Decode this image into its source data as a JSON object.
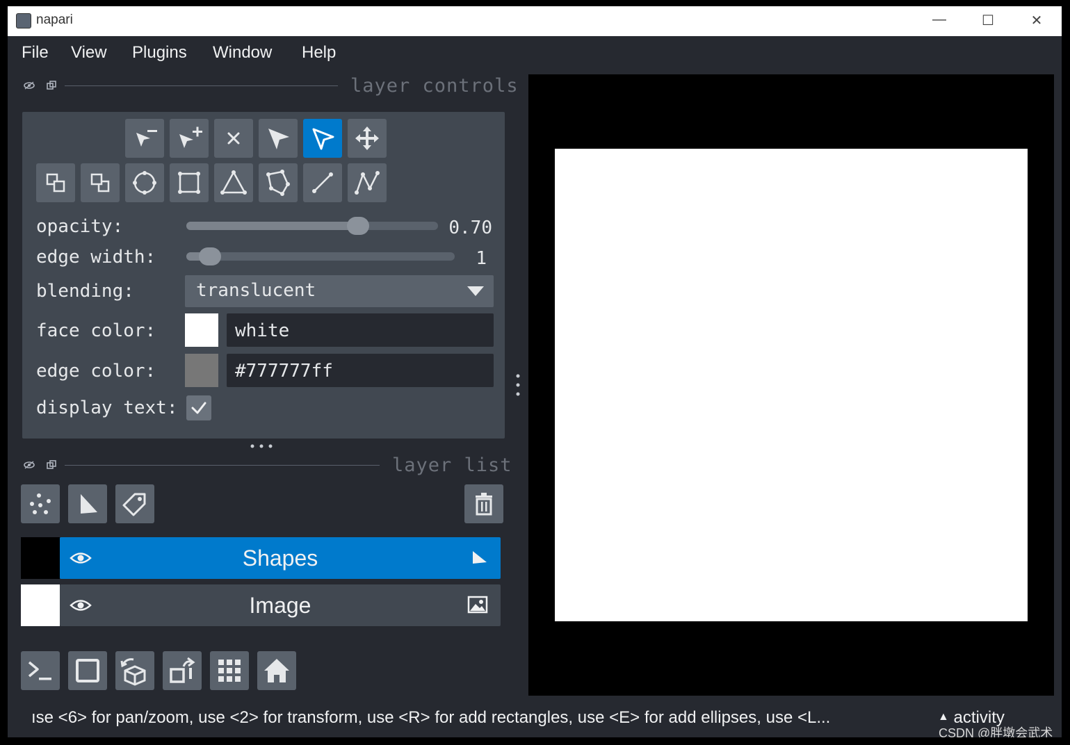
{
  "window": {
    "title": "napari",
    "controls": {
      "minimize": "—",
      "maximize": "☐",
      "close": "✕"
    }
  },
  "menu": [
    "File",
    "View",
    "Plugins",
    "Window",
    "Help"
  ],
  "layer_controls": {
    "title": "layer controls",
    "opacity": {
      "label": "opacity:",
      "value": "0.70",
      "level": 0.7
    },
    "edge_width": {
      "label": "edge width:",
      "value": "1",
      "level": 0.05
    },
    "blending": {
      "label": "blending:",
      "value": "translucent"
    },
    "face_color": {
      "label": "face color:",
      "value": "white",
      "swatch": "#ffffff"
    },
    "edge_color": {
      "label": "edge color:",
      "value": "#777777ff",
      "swatch": "#777777"
    },
    "display_text": {
      "label": "display text:",
      "checked": true
    },
    "active_color": "#007acc"
  },
  "layer_list": {
    "title": "layer list",
    "layers": [
      {
        "name": "Shapes",
        "selected": true,
        "thumb": "#000000",
        "type_icon": "shapes-icon"
      },
      {
        "name": "Image",
        "selected": false,
        "thumb": "#ffffff",
        "type_icon": "image-icon"
      }
    ]
  },
  "status": {
    "message": "ıse <6> for pan/zoom, use <2> for transform, use <R> for add rectangles, use <E> for add ellipses, use <L...",
    "activity": "activity"
  },
  "watermark": "CSDN @胖墩会武术"
}
